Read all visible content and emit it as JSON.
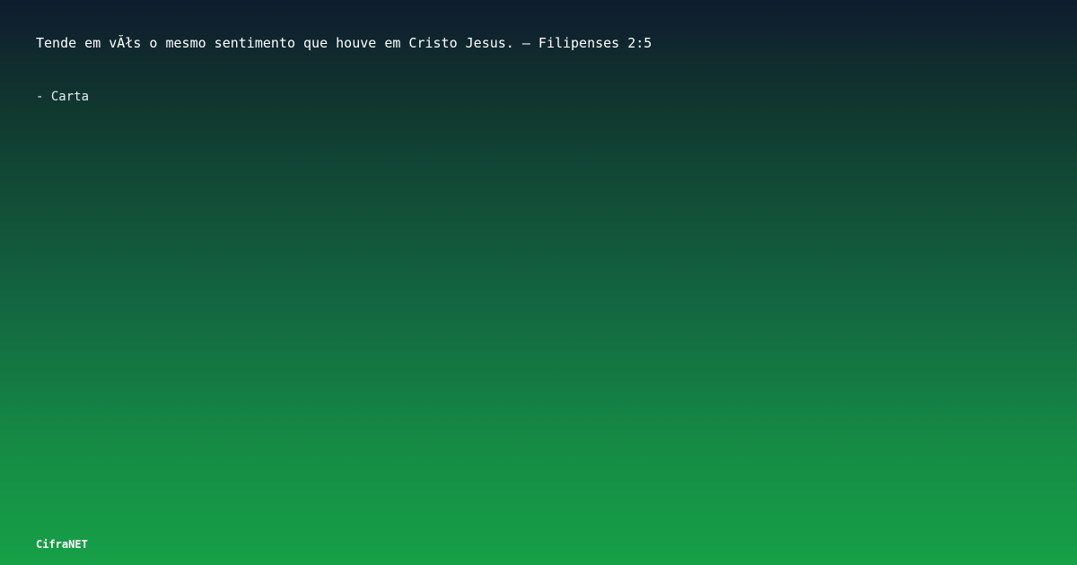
{
  "card": {
    "quote": "Tende em vĂłs o mesmo sentimento que houve em Cristo Jesus. – Filipenses 2:5",
    "source": "- Carta",
    "brand": "CifraNET"
  }
}
